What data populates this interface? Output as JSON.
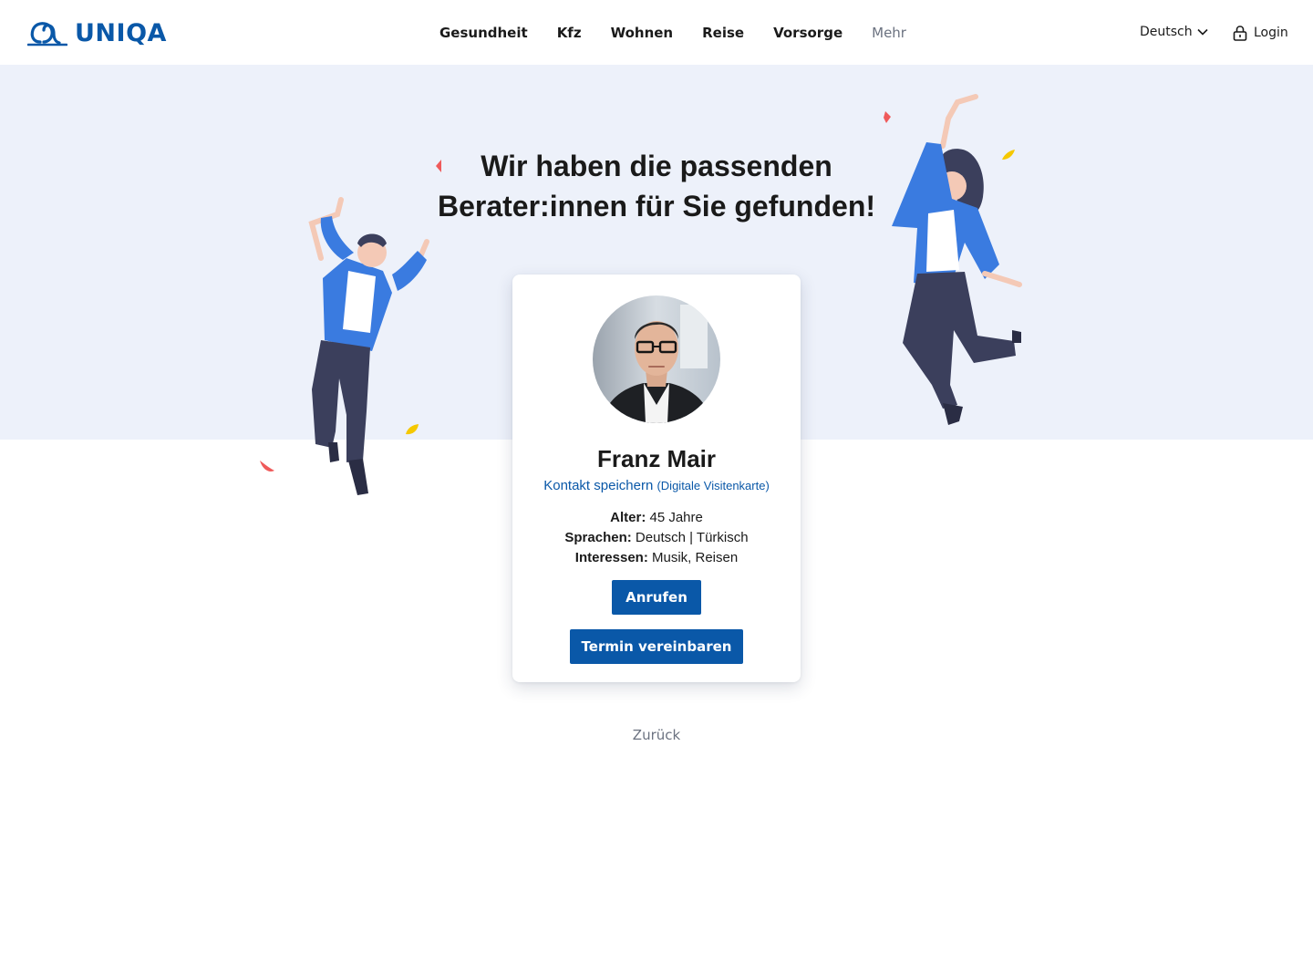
{
  "brand": {
    "name": "UNIQA",
    "color": "#0a58a8",
    "icon": "uniqa-logo-icon"
  },
  "nav": {
    "items": [
      {
        "label": "Gesundheit"
      },
      {
        "label": "Kfz"
      },
      {
        "label": "Wohnen"
      },
      {
        "label": "Reise"
      },
      {
        "label": "Vorsorge"
      },
      {
        "label": "Mehr"
      }
    ]
  },
  "header": {
    "language": "Deutsch",
    "language_icon": "chevron-down-icon",
    "login": "Login",
    "login_icon": "lock-icon"
  },
  "hero": {
    "headline_line1": "Wir haben die passenden",
    "headline_line2": "Berater:innen für Sie gefunden!",
    "background": "#edf1fa"
  },
  "advisor": {
    "name": "Franz Mair",
    "save_contact": "Kontakt speichern",
    "save_contact_hint": "(Digitale Visitenkarte)",
    "facts": [
      {
        "label": "Alter:",
        "value": "45 Jahre"
      },
      {
        "label": "Sprachen:",
        "value": "Deutsch | Türkisch"
      },
      {
        "label": "Interessen:",
        "value": "Musik, Reisen"
      }
    ],
    "call_button": "Anrufen",
    "appointment_button": "Termin vereinbaren"
  },
  "back_link": "Zurück"
}
